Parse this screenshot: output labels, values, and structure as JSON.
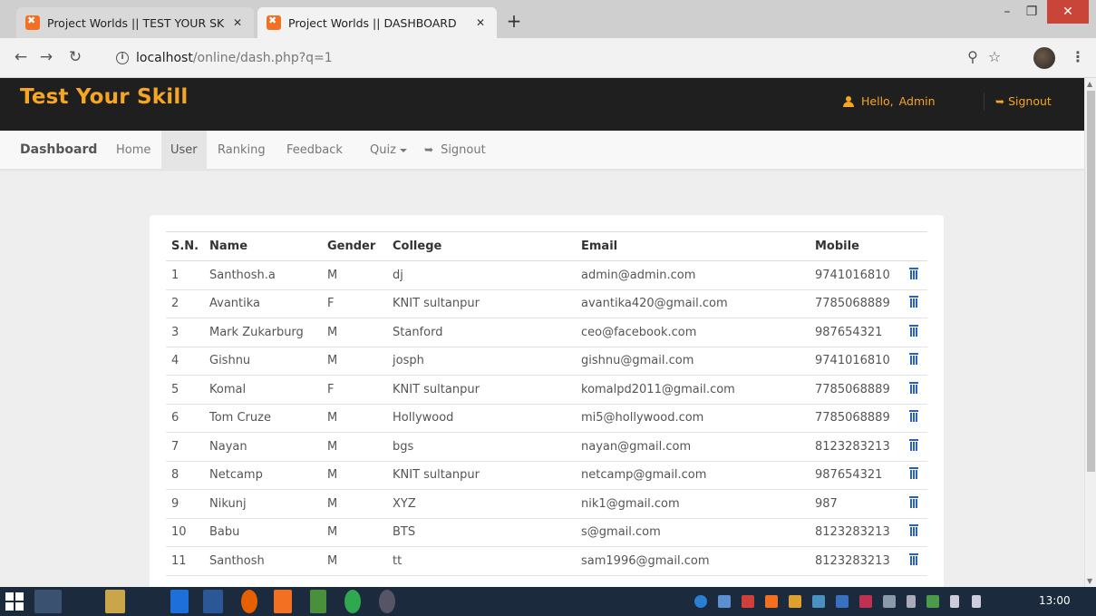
{
  "browser": {
    "tabs": [
      {
        "title": "Project Worlds || TEST YOUR SKIL",
        "active": false
      },
      {
        "title": "Project Worlds || DASHBOARD",
        "active": true
      }
    ],
    "url_host": "localhost",
    "url_path": "/online/dash.php?q=1"
  },
  "header": {
    "logo": "Test Your Skill",
    "hello_label": "Hello,",
    "hello_name": "Admin",
    "signout_label": "Signout",
    "accent_color": "#f5a623"
  },
  "nav": {
    "brand": "Dashboard",
    "items": [
      {
        "label": "Home",
        "active": false
      },
      {
        "label": "User",
        "active": true
      },
      {
        "label": "Ranking",
        "active": false
      },
      {
        "label": "Feedback",
        "active": false
      },
      {
        "label": "Quiz",
        "active": false,
        "dropdown": true
      },
      {
        "label": "Signout",
        "active": false
      }
    ]
  },
  "table": {
    "headers": [
      "S.N.",
      "Name",
      "Gender",
      "College",
      "Email",
      "Mobile"
    ],
    "rows": [
      {
        "sn": "1",
        "name": "Santhosh.a",
        "gender": "M",
        "college": "dj",
        "email": "admin@admin.com",
        "mobile": "9741016810"
      },
      {
        "sn": "2",
        "name": "Avantika",
        "gender": "F",
        "college": "KNIT sultanpur",
        "email": "avantika420@gmail.com",
        "mobile": "7785068889"
      },
      {
        "sn": "3",
        "name": "Mark Zukarburg",
        "gender": "M",
        "college": "Stanford",
        "email": "ceo@facebook.com",
        "mobile": "987654321"
      },
      {
        "sn": "4",
        "name": "Gishnu",
        "gender": "M",
        "college": "josph",
        "email": "gishnu@gmail.com",
        "mobile": "9741016810"
      },
      {
        "sn": "5",
        "name": "Komal",
        "gender": "F",
        "college": "KNIT sultanpur",
        "email": "komalpd2011@gmail.com",
        "mobile": "7785068889"
      },
      {
        "sn": "6",
        "name": "Tom Cruze",
        "gender": "M",
        "college": "Hollywood",
        "email": "mi5@hollywood.com",
        "mobile": "7785068889"
      },
      {
        "sn": "7",
        "name": "Nayan",
        "gender": "M",
        "college": "bgs",
        "email": "nayan@gmail.com",
        "mobile": "8123283213"
      },
      {
        "sn": "8",
        "name": "Netcamp",
        "gender": "M",
        "college": "KNIT sultanpur",
        "email": "netcamp@gmail.com",
        "mobile": "987654321"
      },
      {
        "sn": "9",
        "name": "Nikunj",
        "gender": "M",
        "college": "XYZ",
        "email": "nik1@gmail.com",
        "mobile": "987"
      },
      {
        "sn": "10",
        "name": "Babu",
        "gender": "M",
        "college": "BTS",
        "email": "s@gmail.com",
        "mobile": "8123283213"
      },
      {
        "sn": "11",
        "name": "Santhosh",
        "gender": "M",
        "college": "tt",
        "email": "sam1996@gmail.com",
        "mobile": "8123283213"
      }
    ]
  },
  "taskbar": {
    "clock": "13:00"
  }
}
